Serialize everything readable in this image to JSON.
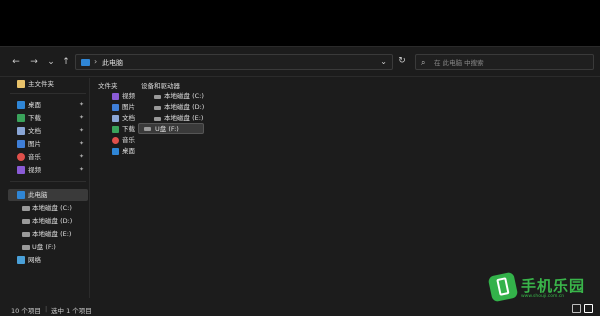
{
  "nav": {
    "back_icon": "←",
    "forward_icon": "→",
    "history_icon": "⌄",
    "up_icon": "↑",
    "address_crumb": "此电脑",
    "address_sep": "›",
    "address_dropdown": "⌄",
    "refresh_icon": "↻",
    "search_icon": "⌕",
    "search_placeholder": "在 此电脑 中搜索"
  },
  "sidebar": {
    "home": "主文件夹",
    "quick": [
      {
        "label": "桌面",
        "icon": "desktop-icon",
        "color": "#2f86d6"
      },
      {
        "label": "下载",
        "icon": "download-icon",
        "color": "#3aa35b"
      },
      {
        "label": "文档",
        "icon": "document-icon",
        "color": "#8aa6d6"
      },
      {
        "label": "图片",
        "icon": "pictures-icon",
        "color": "#3f7fd8"
      },
      {
        "label": "音乐",
        "icon": "music-icon",
        "color": "#e0504b"
      },
      {
        "label": "视频",
        "icon": "video-icon",
        "color": "#8a5bd6"
      }
    ],
    "pin_icon": "✦",
    "thispc": "此电脑",
    "drives": [
      "本地磁盘 (C:)",
      "本地磁盘 (D:)",
      "本地磁盘 (E:)",
      "U盘 (F:)"
    ],
    "network": "网络"
  },
  "main": {
    "folders_title": "文件夹",
    "folders": [
      {
        "label": "视频",
        "color": "#8a5bd6"
      },
      {
        "label": "图片",
        "color": "#3f7fd8"
      },
      {
        "label": "文档",
        "color": "#8aa6d6"
      },
      {
        "label": "下载",
        "color": "#3aa35b"
      },
      {
        "label": "音乐",
        "color": "#e0504b"
      },
      {
        "label": "桌面",
        "color": "#2f86d6"
      }
    ],
    "drives_title": "设备和驱动器",
    "drives": [
      "本地磁盘 (C:)",
      "本地磁盘 (D:)",
      "本地磁盘 (E:)",
      "U盘 (F:)"
    ]
  },
  "status": {
    "count": "10 个项目",
    "separator": "|",
    "selected": "选中 1 个项目"
  },
  "watermark": {
    "text": "手机乐园",
    "sub": "www.shouji.com.cn"
  }
}
